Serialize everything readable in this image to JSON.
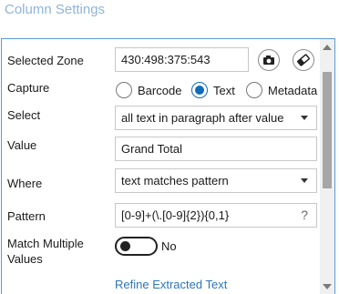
{
  "panel": {
    "title": "Column Settings"
  },
  "selected_zone": {
    "label": "Selected Zone",
    "value": "430:498:375:543"
  },
  "capture": {
    "label": "Capture",
    "options": [
      {
        "label": "Barcode",
        "selected": false
      },
      {
        "label": "Text",
        "selected": true
      },
      {
        "label": "Metadata",
        "selected": false
      }
    ]
  },
  "select": {
    "label": "Select",
    "value": "all text in paragraph after value"
  },
  "value_field": {
    "label": "Value",
    "value": "Grand Total"
  },
  "where": {
    "label": "Where",
    "value": "text matches pattern"
  },
  "pattern": {
    "label": "Pattern",
    "value": "[0-9]+(\\.[0-9]{2}){0,1}",
    "help": "?"
  },
  "match_multiple": {
    "label_line1": "Match Multiple",
    "label_line2": "Values",
    "state_label": "No",
    "on": false
  },
  "refine_link": "Refine Extracted Text",
  "icons": {
    "camera": "camera-icon",
    "eraser": "eraser-icon"
  },
  "colors": {
    "accent": "#0f6cbd",
    "link": "#2e75b6",
    "title": "#8fb4d8",
    "border": "#5b9bd5"
  }
}
